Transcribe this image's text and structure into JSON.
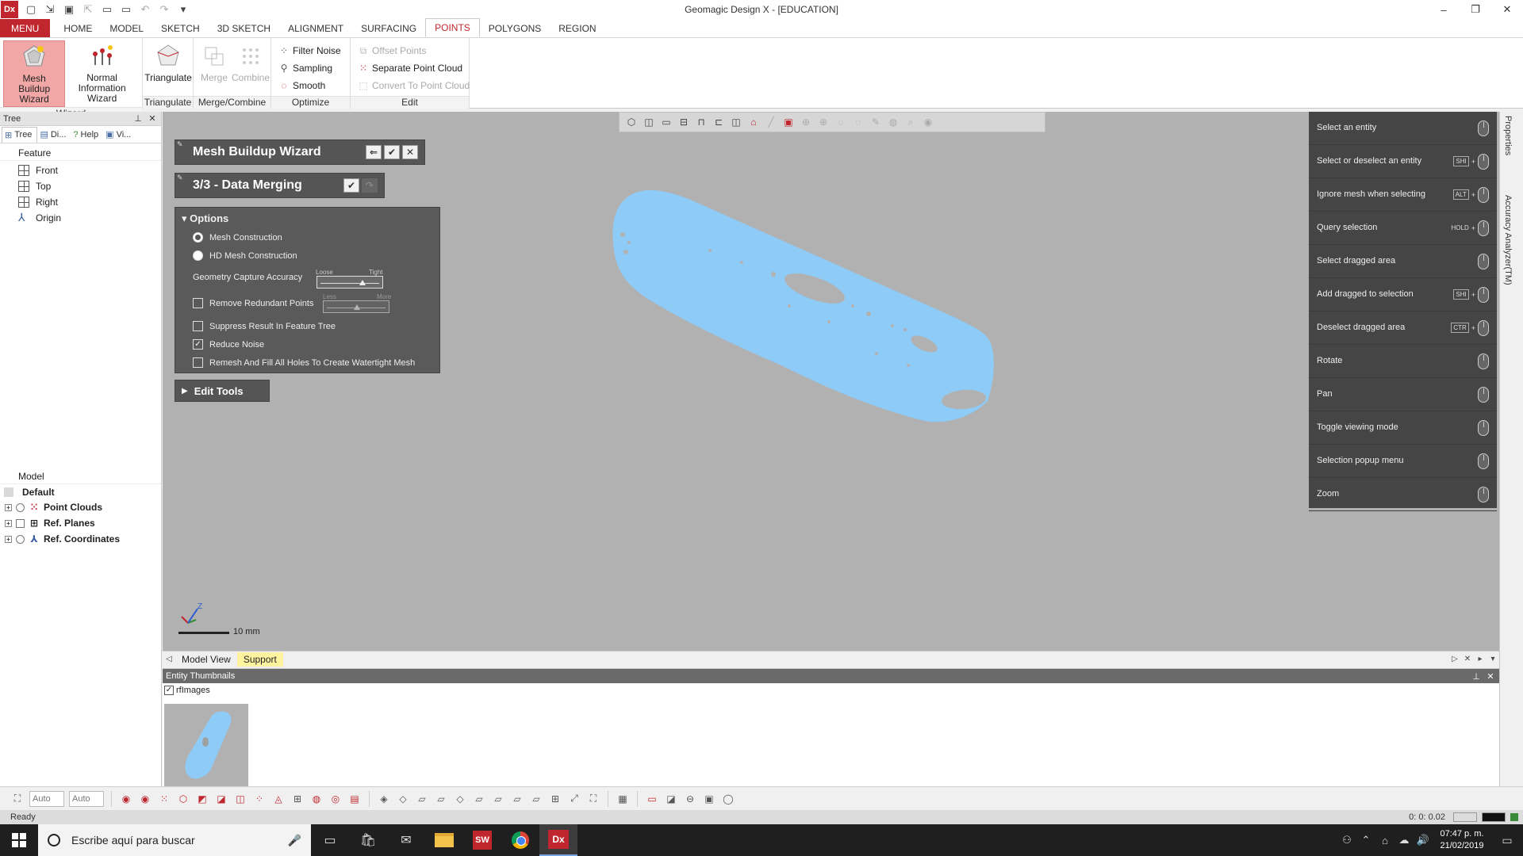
{
  "app": {
    "logo": "Dx",
    "window_title": "Geomagic Design X - [EDUCATION]"
  },
  "ribbon": {
    "tabs": [
      "MENU",
      "HOME",
      "MODEL",
      "SKETCH",
      "3D SKETCH",
      "ALIGNMENT",
      "SURFACING",
      "POINTS",
      "POLYGONS",
      "REGION"
    ],
    "active_tab": "POINTS",
    "groups": {
      "wizard": {
        "label": "Wizard",
        "mesh_buildup": "Mesh Buildup Wizard",
        "normal_info": "Normal Information Wizard"
      },
      "triangulate": {
        "label": "Triangulate",
        "triangulate": "Triangulate"
      },
      "merge_combine": {
        "label": "Merge/Combine",
        "merge": "Merge",
        "combine": "Combine"
      },
      "optimize": {
        "label": "Optimize",
        "filter_noise": "Filter Noise",
        "sampling": "Sampling",
        "smooth": "Smooth"
      },
      "edit": {
        "label": "Edit",
        "offset_points": "Offset Points",
        "separate_point_cloud": "Separate Point Cloud",
        "convert_to_point_cloud": "Convert To Point Cloud"
      }
    }
  },
  "tree_panel": {
    "title": "Tree",
    "tabs": [
      "Tree",
      "Di...",
      "Help",
      "Vi..."
    ],
    "feature_title": "Feature",
    "features": [
      "Front",
      "Top",
      "Right",
      "Origin"
    ],
    "model_title": "Model",
    "model_default": "Default",
    "model_items": [
      "Point Clouds",
      "Ref. Planes",
      "Ref. Coordinates"
    ]
  },
  "wizard": {
    "title": "Mesh Buildup Wizard",
    "step": "3/3 - Data Merging",
    "options_title": "Options",
    "mesh_construction": "Mesh Construction",
    "hd_mesh_construction": "HD Mesh Construction",
    "geometry_capture_accuracy": "Geometry Capture Accuracy",
    "accuracy_loose": "Loose",
    "accuracy_tight": "Tight",
    "accuracy_level": 0.7,
    "remove_redundant_points": "Remove Redundant Points",
    "redundant_less": "Less",
    "redundant_more": "More",
    "redundant_level": 0.5,
    "suppress_result": "Suppress Result In Feature Tree",
    "reduce_noise": "Reduce Noise",
    "remesh_fill": "Remesh And Fill All Holes To Create Watertight Mesh",
    "edit_tools": "Edit Tools"
  },
  "viewport": {
    "scale_label": "10 mm",
    "mesh_color": "#8ecbf7",
    "background_color": "#b1b1b1"
  },
  "hints": [
    {
      "text": "Select an entity",
      "key": ""
    },
    {
      "text": "Select or deselect an entity",
      "key": "SHI"
    },
    {
      "text": "Ignore mesh when selecting",
      "key": "ALT"
    },
    {
      "text": "Query selection",
      "key": "HOLD"
    },
    {
      "text": "Select dragged area",
      "key": ""
    },
    {
      "text": "Add dragged to selection",
      "key": "SHI"
    },
    {
      "text": "Deselect dragged area",
      "key": "CTR"
    },
    {
      "text": "Rotate",
      "key": ""
    },
    {
      "text": "Pan",
      "key": ""
    },
    {
      "text": "Toggle viewing mode",
      "key": ""
    },
    {
      "text": "Selection popup menu",
      "key": ""
    },
    {
      "text": "Zoom",
      "key": ""
    }
  ],
  "right_tabs": {
    "properties": "Properties",
    "accuracy": "Accuracy Analyzer(TM)"
  },
  "view_tabs": {
    "model_view": "Model View",
    "support": "Support"
  },
  "thumbnails": {
    "title": "Entity Thumbnails",
    "checkbox_label": "rfImages"
  },
  "bottom_toolbar": {
    "combo1": "Auto",
    "combo2": "Auto"
  },
  "status": {
    "text": "Ready",
    "time": "0: 0: 0.02"
  },
  "taskbar": {
    "search_placeholder": "Escribe aquí para buscar",
    "time": "07:47 p. m.",
    "date": "21/02/2019"
  }
}
